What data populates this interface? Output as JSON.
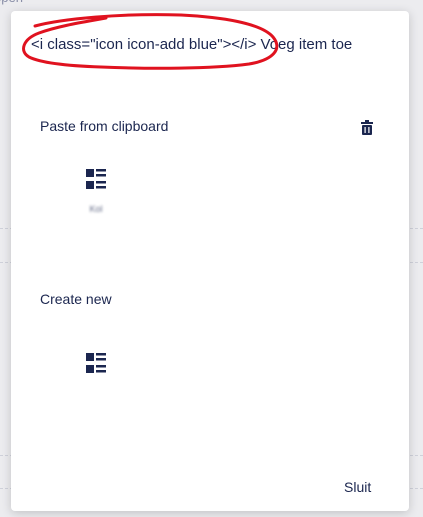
{
  "background": {
    "top_text": "ppen"
  },
  "dialog": {
    "title": "<i class=\"icon icon-add blue\"></i> Voeg item toe",
    "clipboard_section": {
      "title": "Paste from clipboard",
      "items": [
        {
          "caption_line1": "Kol",
          "caption_line2": ""
        }
      ]
    },
    "create_section": {
      "title": "Create new",
      "items": [
        {
          "caption": ""
        }
      ]
    },
    "close_label": "Sluit"
  },
  "icons": {
    "title": "scribble-annotation",
    "trash": "trash-icon",
    "item": "list-block-icon"
  },
  "colors": {
    "text": "#1b264f",
    "annotation": "#e0121f",
    "modal_bg": "#ffffff",
    "page_bg": "#ececef"
  }
}
